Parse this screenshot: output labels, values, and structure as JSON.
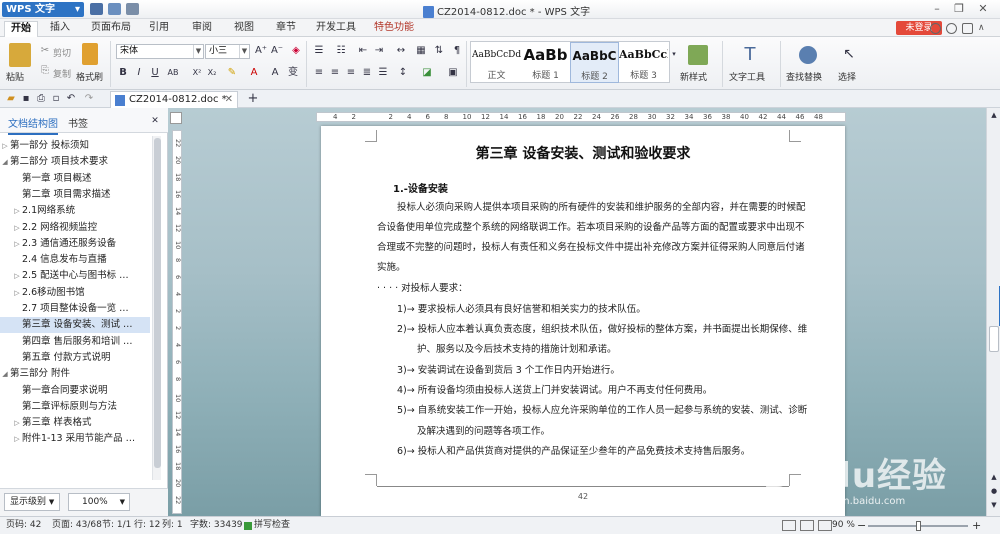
{
  "app": {
    "menu_label": "WPS 文字",
    "document_title": "CZ2014-0812.doc * - WPS 文字"
  },
  "ribbon_tabs": [
    "开始",
    "插入",
    "页面布局",
    "引用",
    "审阅",
    "视图",
    "章节",
    "开发工具",
    "特色功能"
  ],
  "login_button": "未登录",
  "ribbon": {
    "paste": "粘贴",
    "cut": "剪切",
    "copy": "复制",
    "format_painter": "格式刷",
    "font_name": "宋体",
    "font_size": "小三",
    "styles": [
      {
        "preview": "AaBbCcDd",
        "name": "正文"
      },
      {
        "preview": "AaBb",
        "name": "标题 1"
      },
      {
        "preview": "AaBbC",
        "name": "标题 2"
      },
      {
        "preview": "AaBbCcl",
        "name": "标题 3"
      }
    ],
    "new_style": "新样式",
    "text_tools": "文字工具",
    "find_replace": "查找替换",
    "select": "选择"
  },
  "doc_tab": "CZ2014-0812.doc *",
  "nav": {
    "tab_outline": "文档结构图",
    "tab_bookmark": "书签",
    "items": [
      {
        "label": "第一部分    投标须知",
        "level": 0,
        "arrow": "▷"
      },
      {
        "label": "第二部分    项目技术要求",
        "level": 0,
        "arrow": "◢"
      },
      {
        "label": "第一章 项目概述",
        "level": 1,
        "arrow": ""
      },
      {
        "label": "第二章 项目需求描述",
        "level": 1,
        "arrow": ""
      },
      {
        "label": "2.1网络系统",
        "level": 1,
        "arrow": "▷"
      },
      {
        "label": "2.2   网络视频监控",
        "level": 1,
        "arrow": "▷"
      },
      {
        "label": "2.3   通信通还服务设备",
        "level": 1,
        "arrow": "▷"
      },
      {
        "label": "2.4   信息发布与直播",
        "level": 1,
        "arrow": ""
      },
      {
        "label": "2.5   配送中心与图书标 …",
        "level": 1,
        "arrow": "▷"
      },
      {
        "label": "2.6移动图书馆",
        "level": 1,
        "arrow": "▷"
      },
      {
        "label": "2.7   项目整体设备一览 …",
        "level": 1,
        "arrow": ""
      },
      {
        "label": "第三章 设备安装、测试 …",
        "level": 1,
        "arrow": "",
        "selected": true
      },
      {
        "label": "第四章 售后服务和培训 …",
        "level": 1,
        "arrow": ""
      },
      {
        "label": "第五章 付款方式说明",
        "level": 1,
        "arrow": ""
      },
      {
        "label": "第三部分    附件",
        "level": 0,
        "arrow": "◢"
      },
      {
        "label": "第一章合同要求说明",
        "level": 1,
        "arrow": ""
      },
      {
        "label": "第二章评标原则与方法",
        "level": 1,
        "arrow": ""
      },
      {
        "label": "第三章   样表格式",
        "level": 1,
        "arrow": "▷"
      },
      {
        "label": "附件1-13   采用节能产品 …",
        "level": 1,
        "arrow": "▷"
      }
    ],
    "show_level": "显示级别",
    "zoom": "100%"
  },
  "ruler_numbers": [
    "4",
    "2",
    "",
    "2",
    "4",
    "6",
    "8",
    "10",
    "12",
    "14",
    "16",
    "18",
    "20",
    "22",
    "24",
    "26",
    "28",
    "30",
    "32",
    "34",
    "36",
    "38",
    "40",
    "42",
    "44",
    "46",
    "48"
  ],
  "vruler_numbers": [
    "22",
    "20",
    "18",
    "16",
    "14",
    "12",
    "10",
    "8",
    "6",
    "4",
    "2",
    "2",
    "4",
    "6",
    "8",
    "10",
    "12",
    "14",
    "16",
    "18",
    "20",
    "22"
  ],
  "page": {
    "chapter_title": "第三章 设备安装、测试和验收要求",
    "section_heading": "1.-设备安装",
    "lines": [
      "投标人必须向采购人提供本项目采购的所有硬件的安装和维护服务的全部内容，并在需要的时候配",
      "合设备使用单位完成整个系统的网络联调工作。若本项目采购的设备产品等方面的配置或要求中出现不",
      "合理或不完整的问题时，投标人有责任和义务在投标文件中提出补充修改方案并征得采购人同意后付诸",
      "实施。",
      "· · · · 对投标人要求：",
      "1)→ 要求投标人必须具有良好信誉和相关实力的技术队伍。",
      "2)→ 投标人应本着认真负责态度，组织技术队伍，做好投标的整体方案，并书面提出长期保修、维",
      "护、服务以及今后技术支持的措施计划和承诺。",
      "3)→ 安装调试在设备到货后 3 个工作日内开始进行。",
      "4)→ 所有设备均须由投标人送货上门并安装调试。用户不再支付任何费用。",
      "5)→ 自系统安装工作一开始，投标人应允许采购单位的工作人员一起参与系统的安装、测试、诊断",
      "及解决遇到的问题等各项工作。",
      "6)→ 投标人和产品供货商对提供的产品保证至少叁年的产品免费技术支持售后服务。"
    ],
    "page_number": "42"
  },
  "watermark": {
    "main": "Baidu经验",
    "sub": "jingyan.baidu.com"
  },
  "status": {
    "page": "页码: 42",
    "pages": "页面: 43/68",
    "section": "节: 1/1",
    "row": "行: 12",
    "col": "列: 1",
    "words": "字数: 33439",
    "spell": "拼写检查",
    "zoom": "90 %"
  }
}
